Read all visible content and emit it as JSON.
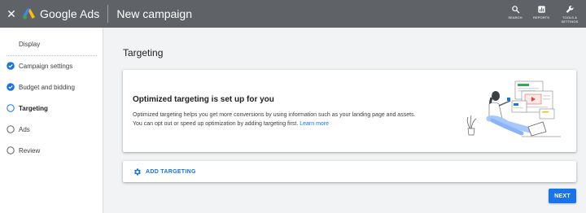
{
  "header": {
    "close_icon": "close-icon",
    "logo_icon": "google-ads-logo-icon",
    "app_name": "Google Ads",
    "title": "New campaign",
    "actions": [
      {
        "icon": "search-icon",
        "label": "SEARCH"
      },
      {
        "icon": "reports-icon",
        "label": "REPORTS"
      },
      {
        "icon": "wrench-icon",
        "label_line1": "TOOLS &",
        "label_line2": "SETTINGS"
      }
    ]
  },
  "sidebar": {
    "section_label": "Display",
    "items": [
      {
        "label": "Campaign settings",
        "state": "complete",
        "icon": "check-circle-icon"
      },
      {
        "label": "Budget and bidding",
        "state": "complete",
        "icon": "check-circle-icon"
      },
      {
        "label": "Targeting",
        "state": "current",
        "icon": "open-circle-icon"
      },
      {
        "label": "Ads",
        "state": "pending",
        "icon": "open-circle-icon"
      },
      {
        "label": "Review",
        "state": "pending",
        "icon": "open-circle-icon"
      }
    ]
  },
  "main": {
    "title": "Targeting",
    "card": {
      "heading": "Optimized targeting is set up for you",
      "text_line1": "Optimized targeting helps you get more conversions by using information such as your landing page and assets.",
      "text_line2": "You can opt out or speed up optimization by adding targeting first.",
      "link": "Learn more",
      "illustration": "person-with-laptop-illustration"
    },
    "add_targeting": {
      "icon": "gear-icon",
      "label": "ADD TARGETING"
    },
    "next_label": "NEXT"
  },
  "colors": {
    "topbar": "#5f6368",
    "accent": "#1a73e8",
    "background": "#f1f3f4"
  }
}
